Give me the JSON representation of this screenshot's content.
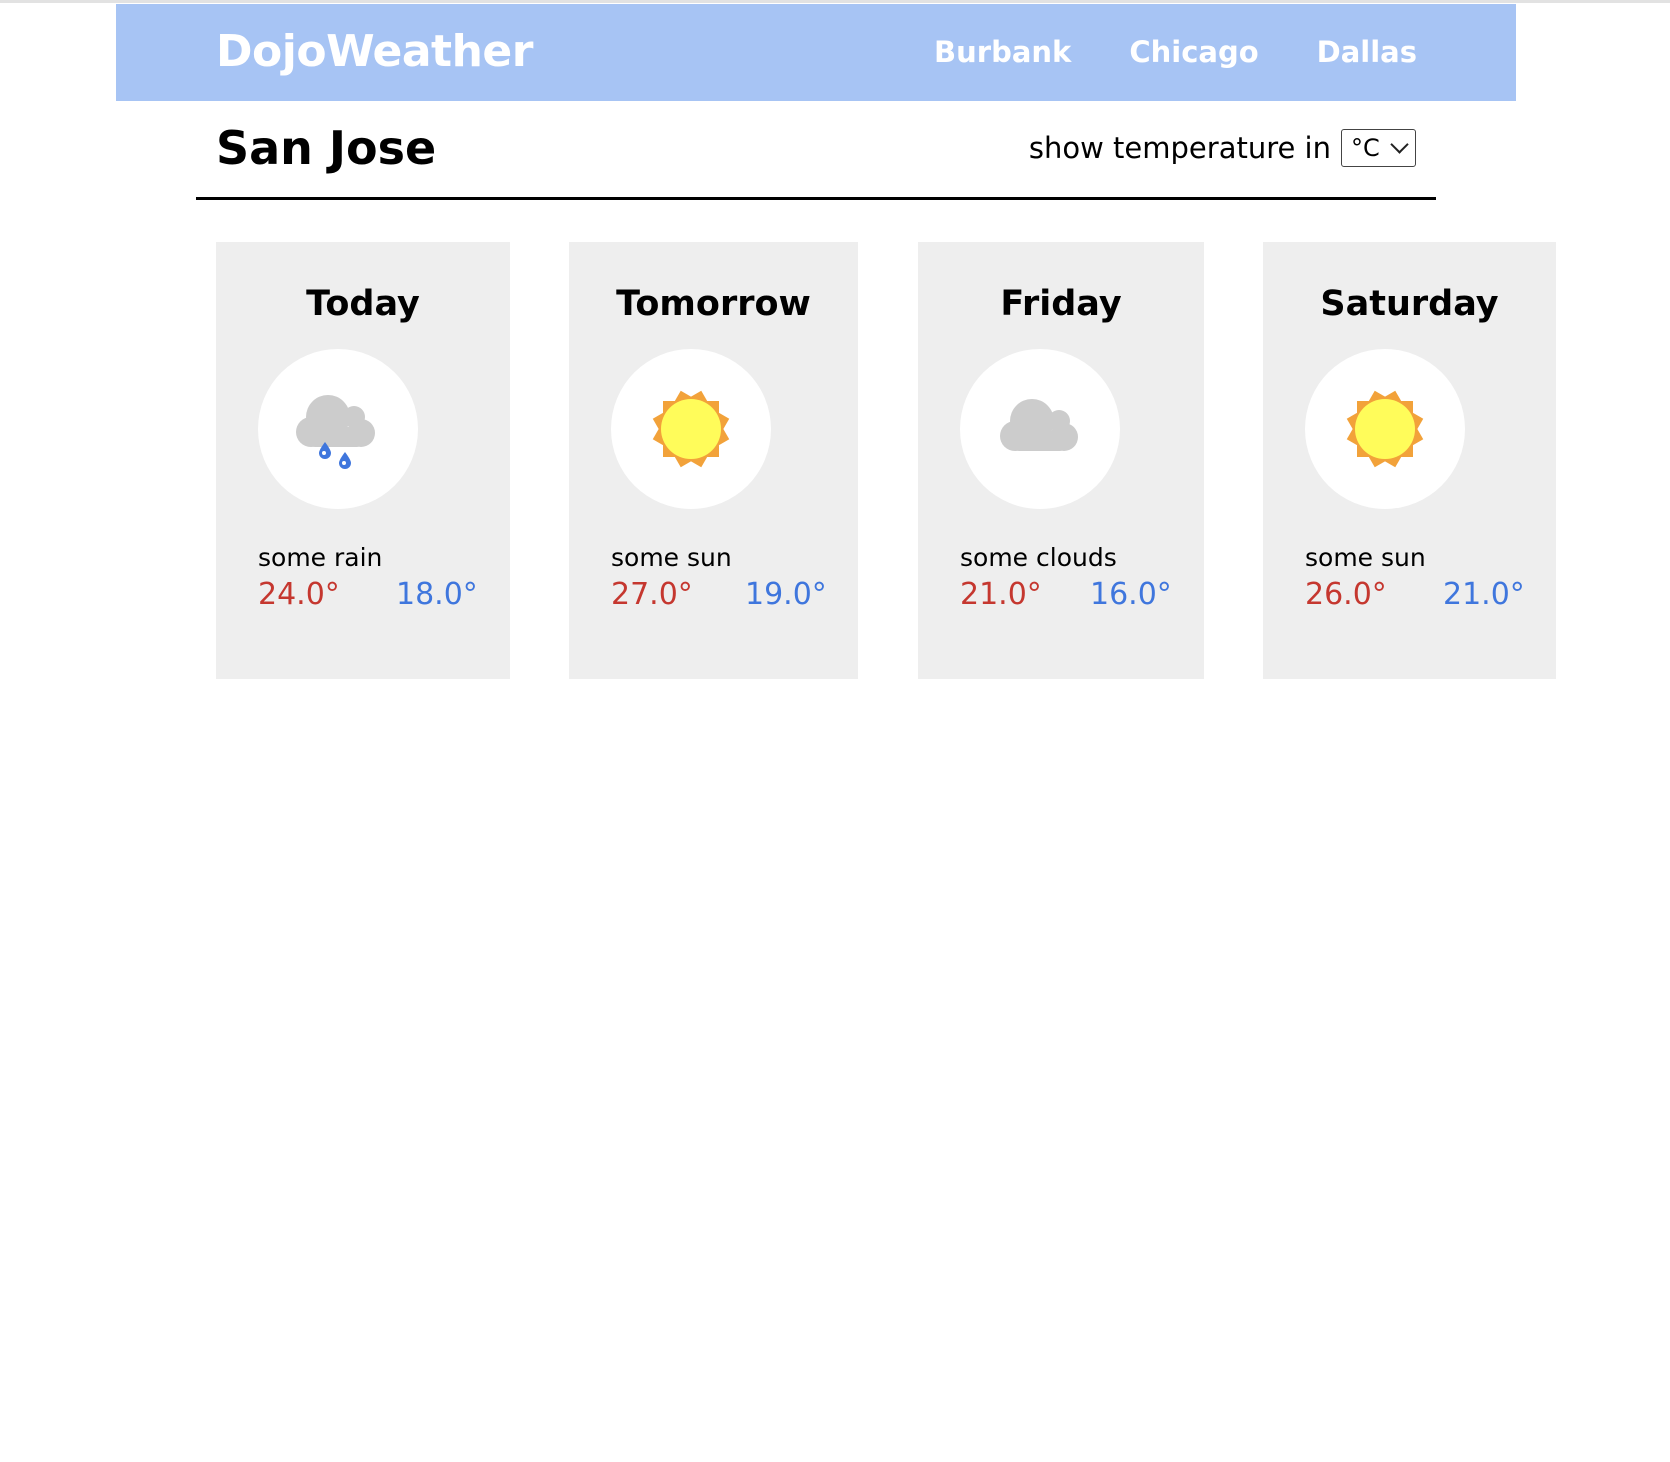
{
  "header": {
    "logo": "DojoWeather",
    "nav": [
      "Burbank",
      "Chicago",
      "Dallas"
    ]
  },
  "city": "San Jose",
  "unit_control": {
    "label": "show temperature in",
    "selected": "°C"
  },
  "forecast": [
    {
      "day": "Today",
      "icon": "rain-cloud-icon",
      "desc": "some rain",
      "high": "24.0°",
      "low": "18.0°"
    },
    {
      "day": "Tomorrow",
      "icon": "sun-icon",
      "desc": "some sun",
      "high": "27.0°",
      "low": "19.0°"
    },
    {
      "day": "Friday",
      "icon": "cloud-icon",
      "desc": "some clouds",
      "high": "21.0°",
      "low": "16.0°"
    },
    {
      "day": "Saturday",
      "icon": "sun-icon",
      "desc": "some sun",
      "high": "26.0°",
      "low": "21.0°"
    }
  ],
  "colors": {
    "navbar": "#a7c4f4",
    "card": "#eeeeee",
    "high_temp": "#c5372f",
    "low_temp": "#3f76dd",
    "sun_fill": "#fffc5a",
    "sun_rays": "#f2a23a",
    "cloud": "#cccccc",
    "rain": "#3f76dd"
  }
}
